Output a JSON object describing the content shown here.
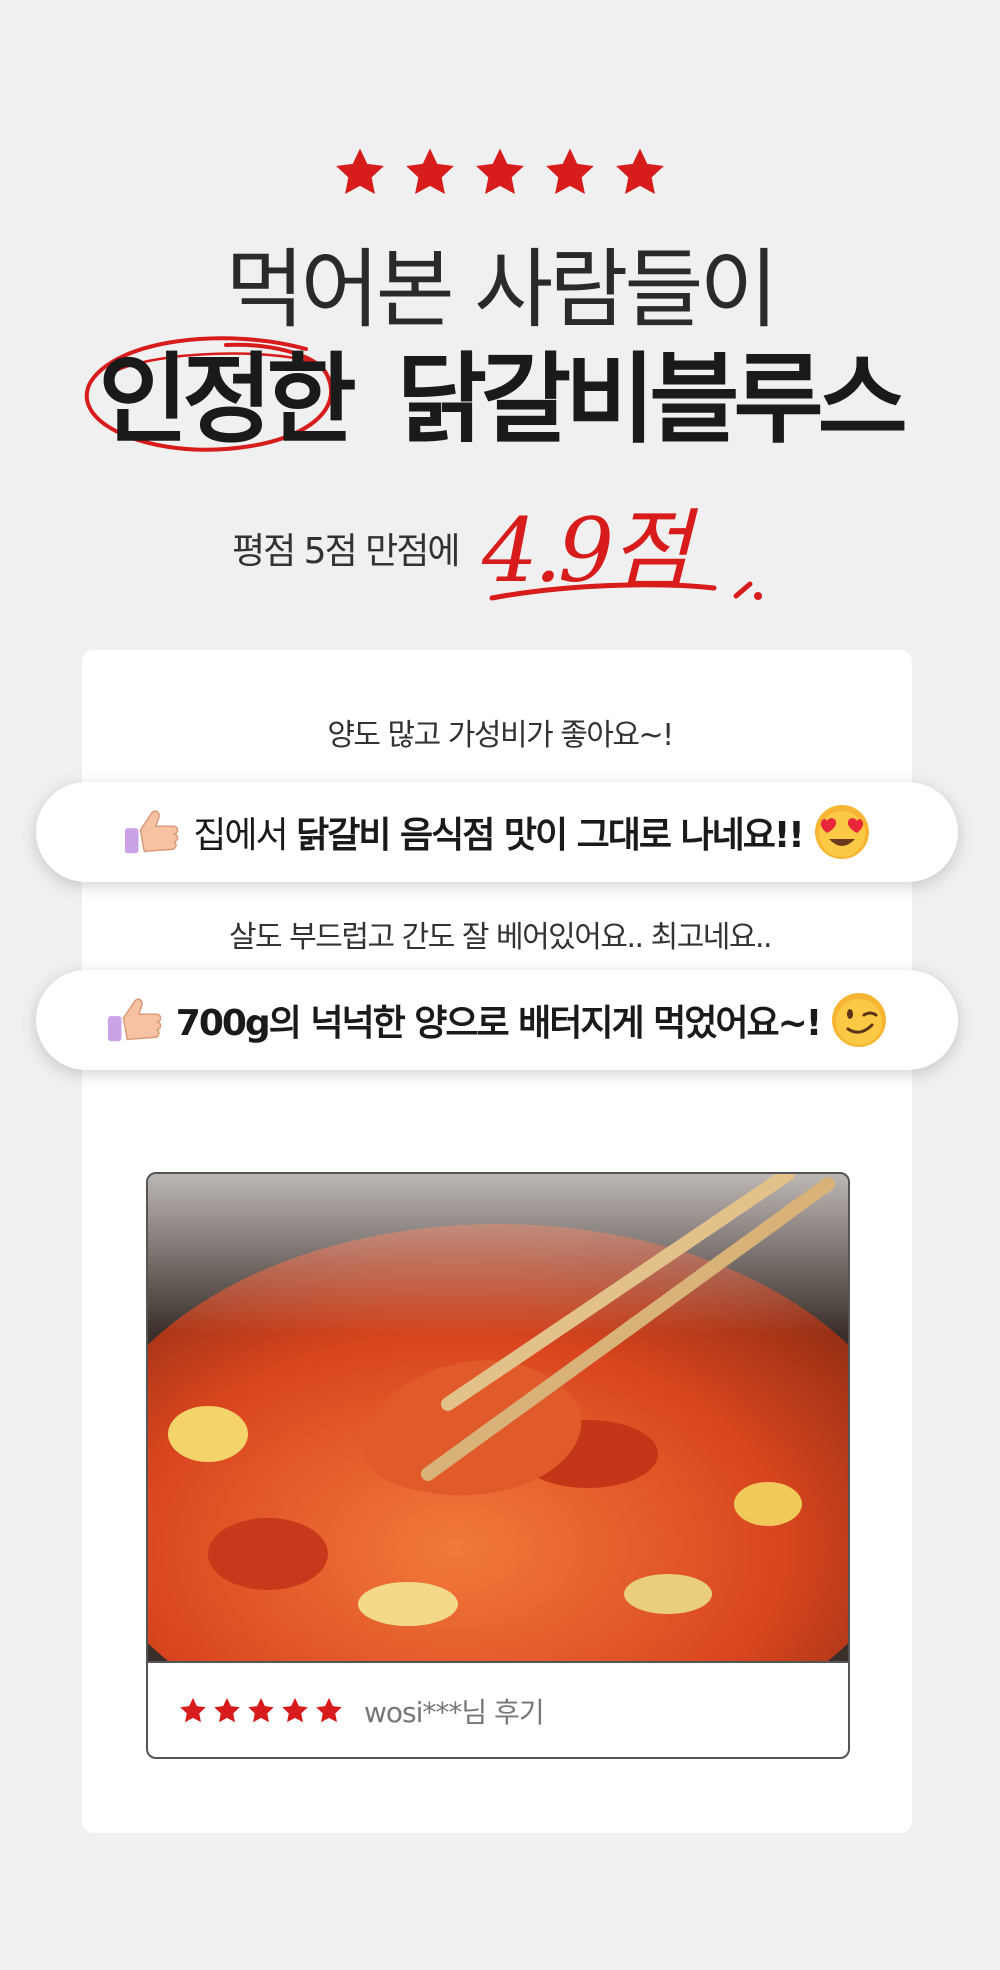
{
  "header": {
    "star_count": 5,
    "headline_line1": "먹어본 사람들이",
    "headline_circled": "인정한",
    "headline_rest": "닭갈비블루스",
    "rating_prefix": "평점 5점 만점에",
    "rating_score": "4.9점"
  },
  "reviews": [
    {
      "type": "plain",
      "text": "양도 많고 가성비가 좋아요~!"
    },
    {
      "type": "pill",
      "lead": "집에서 ",
      "bold": "닭갈비 음식점 맛이 그대로 나네요!!",
      "icon": "thumbs-up-icon",
      "emoji": "heart-eyes-emoji"
    },
    {
      "type": "plain",
      "text": "살도 부드럽고 간도 잘 베어있어요.. 최고네요.."
    },
    {
      "type": "pill",
      "lead": "",
      "bold": "700g의 넉넉한 양으로 배터지게 먹었어요~!",
      "icon": "thumbs-up-icon",
      "emoji": "wink-emoji"
    }
  ],
  "photo_review": {
    "star_count": 5,
    "reviewer": "wosi***님 후기"
  },
  "colors": {
    "accent_red": "#d81b1b",
    "background": "#f0f0f0",
    "card": "#ffffff"
  }
}
